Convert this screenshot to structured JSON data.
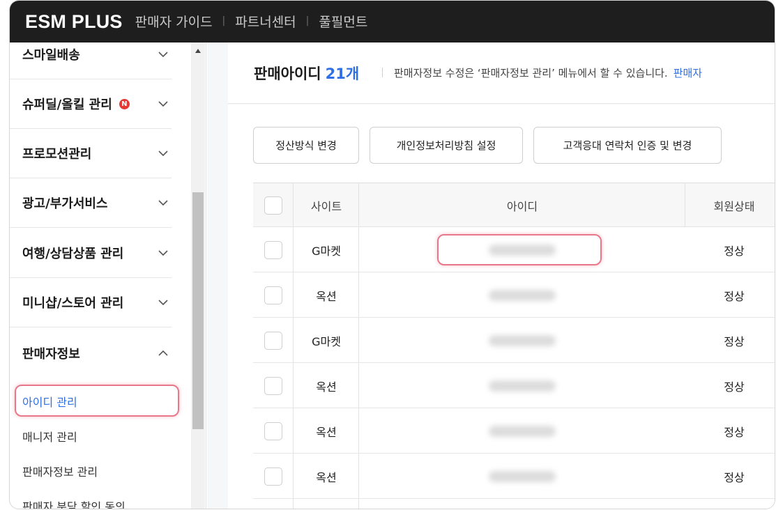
{
  "topbar": {
    "logo": "ESM PLUS",
    "nav": [
      "판매자 가이드",
      "파트너센터",
      "풀필먼트"
    ]
  },
  "sidebar": {
    "menus": [
      {
        "label": "스마일배송",
        "expanded": false,
        "badge": ""
      },
      {
        "label": "슈퍼딜/올킬 관리",
        "expanded": false,
        "badge": "N"
      },
      {
        "label": "프로모션관리",
        "expanded": false,
        "badge": ""
      },
      {
        "label": "광고/부가서비스",
        "expanded": false,
        "badge": ""
      },
      {
        "label": "여행/상담상품 관리",
        "expanded": false,
        "badge": ""
      },
      {
        "label": "미니샵/스토어 관리",
        "expanded": false,
        "badge": ""
      },
      {
        "label": "판매자정보",
        "expanded": true,
        "badge": ""
      }
    ],
    "submenu": [
      "아이디 관리",
      "매니저 관리",
      "판매자정보 관리",
      "판매자 분담 할인 동의"
    ],
    "active_submenu": "아이디 관리"
  },
  "page_header": {
    "title": "판매아이디",
    "count": "21개",
    "description": "판매자정보 수정은 ‘판매자정보 관리’ 메뉴에서 할 수 있습니다.",
    "link": "판매자"
  },
  "actions": [
    "정산방식 변경",
    "개인정보처리방침 설정",
    "고객응대 연락처 인증 및 변경"
  ],
  "table": {
    "columns": [
      "사이트",
      "아이디",
      "회원상태"
    ],
    "rows": [
      {
        "site": "G마켓",
        "status": "정상"
      },
      {
        "site": "옥션",
        "status": "정상"
      },
      {
        "site": "G마켓",
        "status": "정상"
      },
      {
        "site": "옥션",
        "status": "정상"
      },
      {
        "site": "옥션",
        "status": "정상"
      },
      {
        "site": "옥션",
        "status": "정상"
      }
    ]
  },
  "colors": {
    "accent": "#2f6fe6",
    "highlight": "#e8778a",
    "badge": "#e53935",
    "topbar": "#1e1e1e"
  }
}
